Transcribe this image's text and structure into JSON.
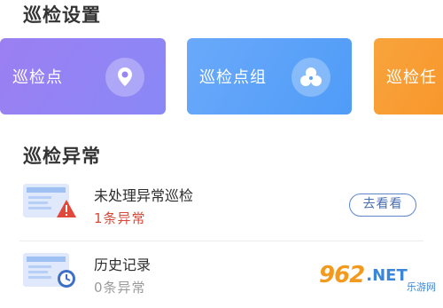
{
  "sections": {
    "settings_title": "巡检设置",
    "abnormal_title": "巡检异常"
  },
  "cards": [
    {
      "label": "巡检点",
      "icon": "location-pin-icon",
      "color": "#8f85f4"
    },
    {
      "label": "巡检点组",
      "icon": "cluster-icon",
      "color": "#5aa2f8"
    },
    {
      "label": "巡检任",
      "icon": "",
      "color": "#f79c32"
    }
  ],
  "rows": [
    {
      "title": "未处理异常巡检",
      "subtitle": "1条异常",
      "icon": "document-warning-icon",
      "button": "去看看"
    },
    {
      "title": "历史记录",
      "subtitle": "0条异常",
      "icon": "document-clock-icon"
    }
  ],
  "watermark": {
    "logo": "962",
    "net": ".NET",
    "sub": "乐游网"
  }
}
